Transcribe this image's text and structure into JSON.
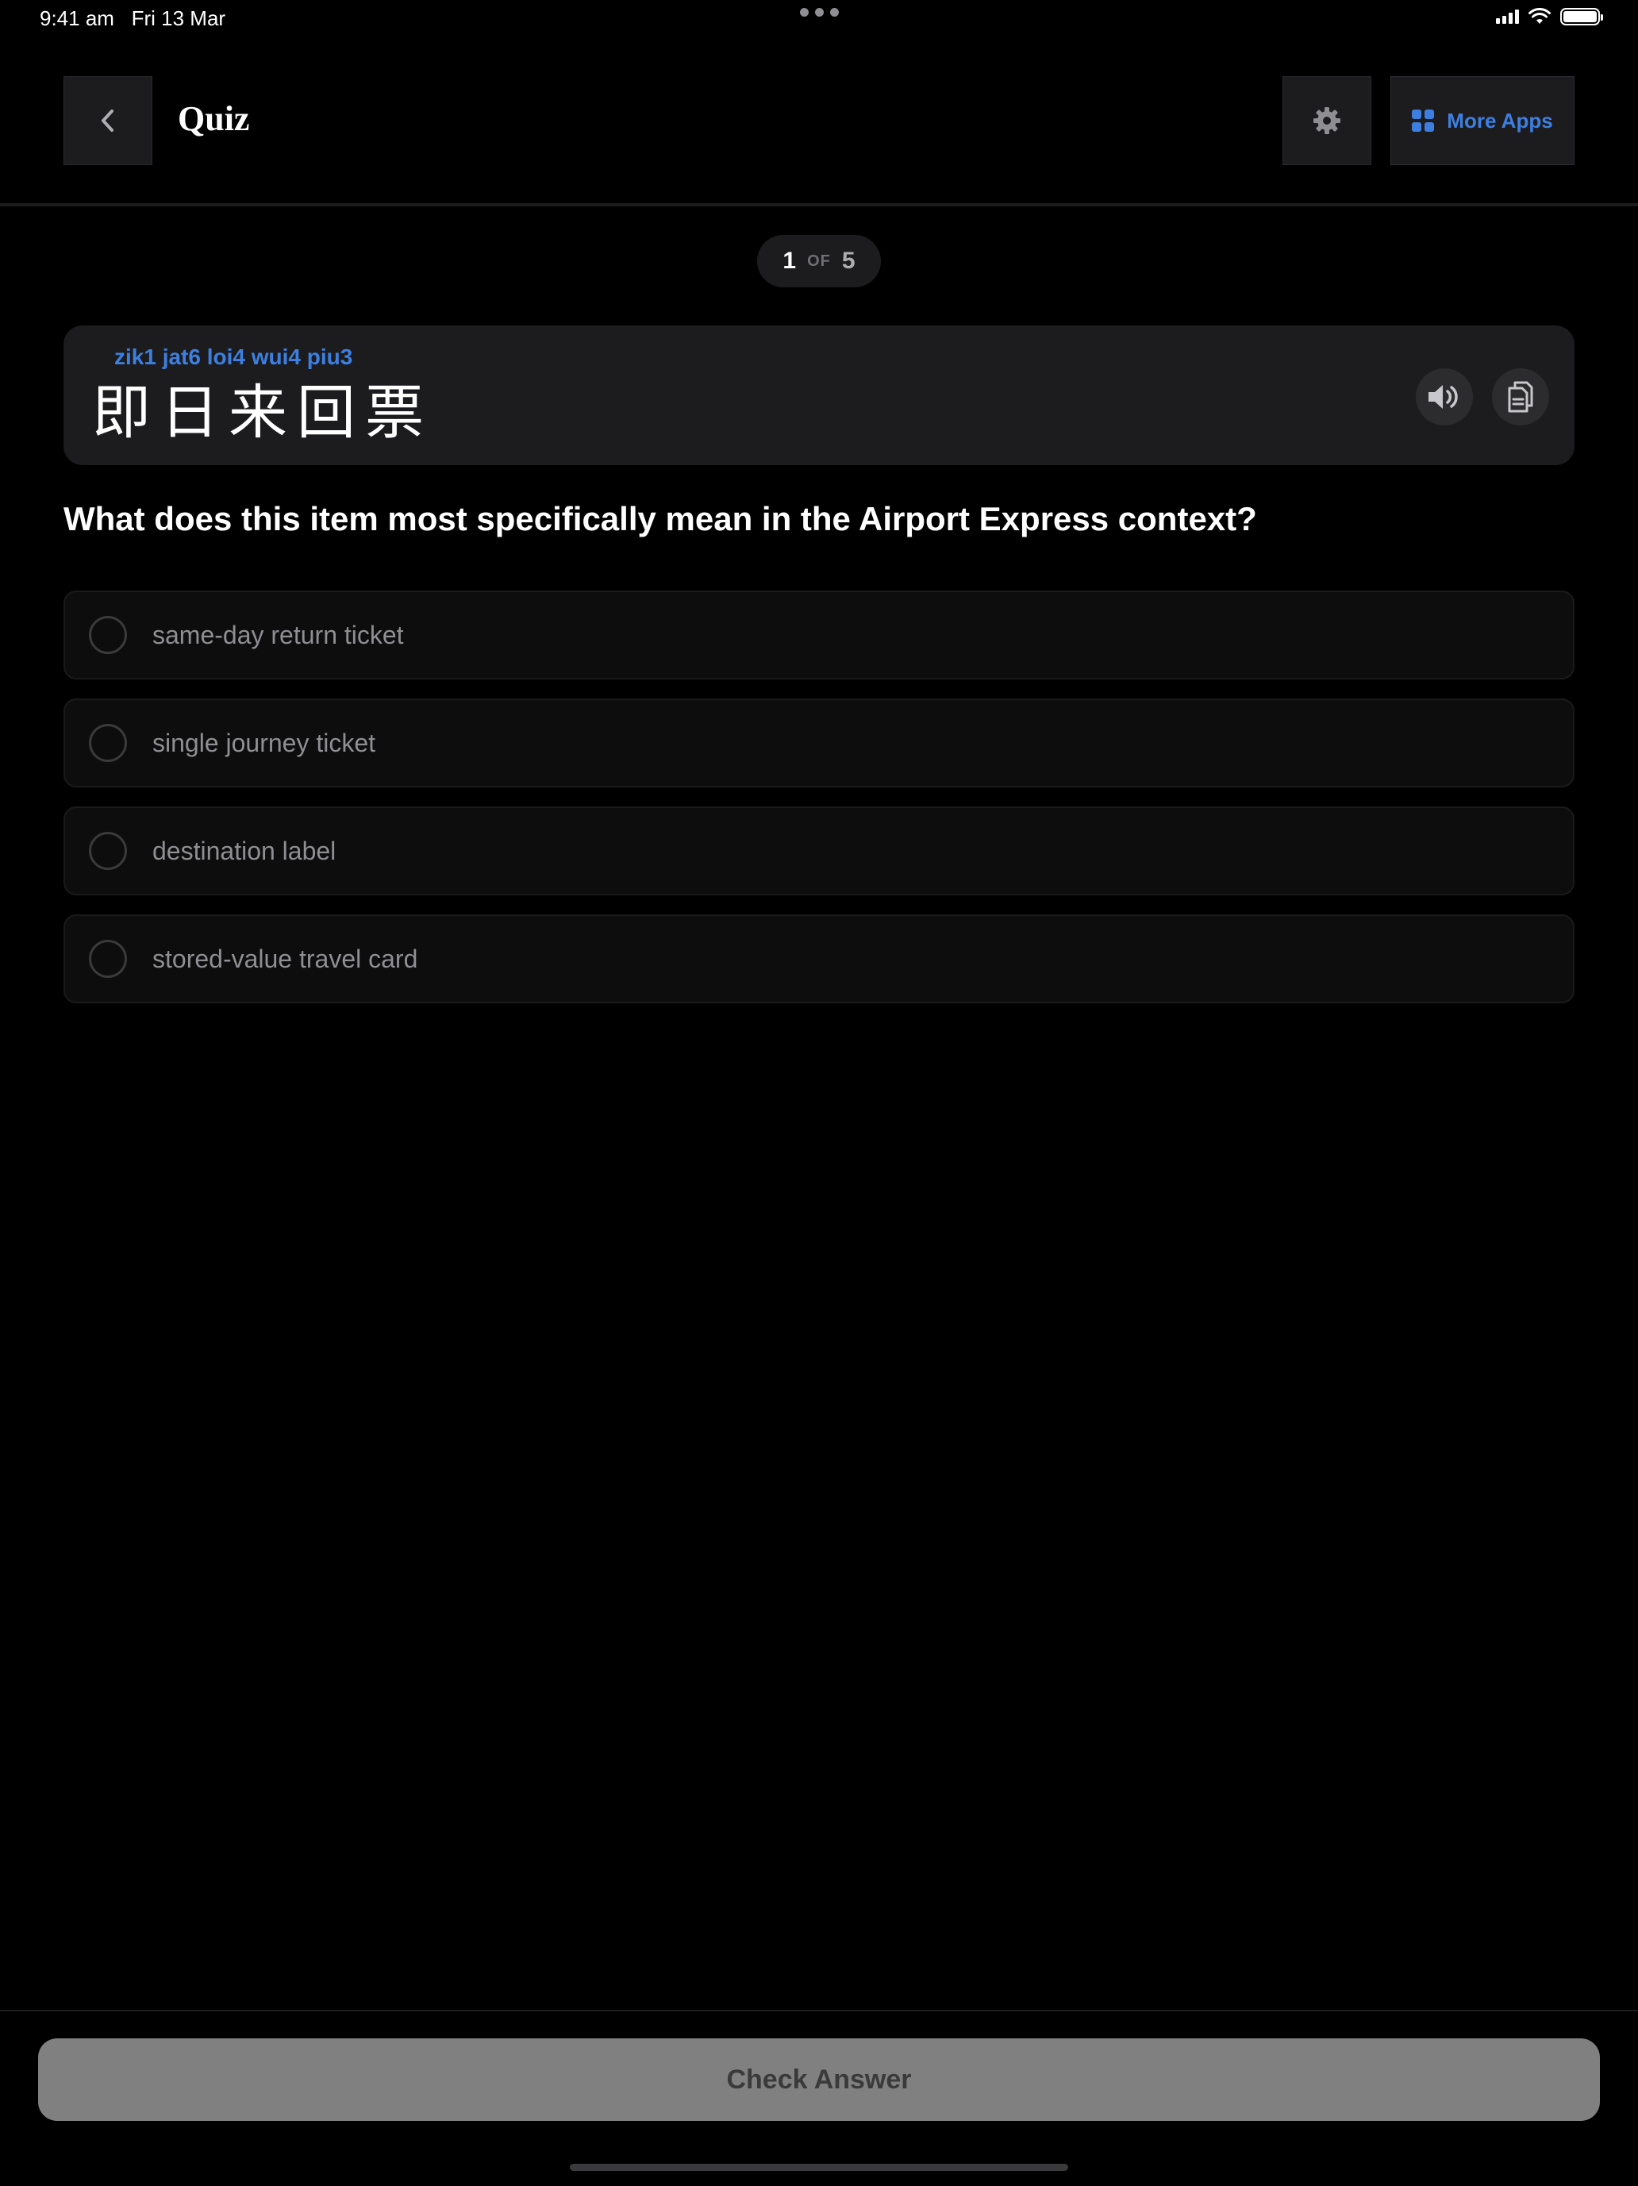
{
  "status_bar": {
    "time": "9:41 am",
    "date": "Fri 13 Mar",
    "icons": [
      "signal-icon",
      "wifi-icon",
      "battery-icon"
    ]
  },
  "header": {
    "title": "Quiz",
    "back_icon": "chevron-left-icon",
    "settings_icon": "gear-icon",
    "more_apps_label": "More Apps",
    "more_apps_icon": "grid-icon"
  },
  "progress": {
    "current": "1",
    "of_label": "OF",
    "total": "5"
  },
  "word": {
    "romanization": "zik1 jat6 loi4 wui4 piu3",
    "hanzi": "即日来回票",
    "speak_icon": "speaker-icon",
    "copy_icon": "copy-icon"
  },
  "question": "What does this item most specifically mean in the Airport Express context?",
  "options": [
    {
      "label": "same-day return ticket"
    },
    {
      "label": "single journey ticket"
    },
    {
      "label": "destination label"
    },
    {
      "label": "stored-value travel card"
    }
  ],
  "footer": {
    "check_label": "Check Answer"
  },
  "colors": {
    "accent": "#3d7fe0",
    "background": "#000000",
    "card": "#1c1c1e",
    "button_disabled": "#808080"
  }
}
